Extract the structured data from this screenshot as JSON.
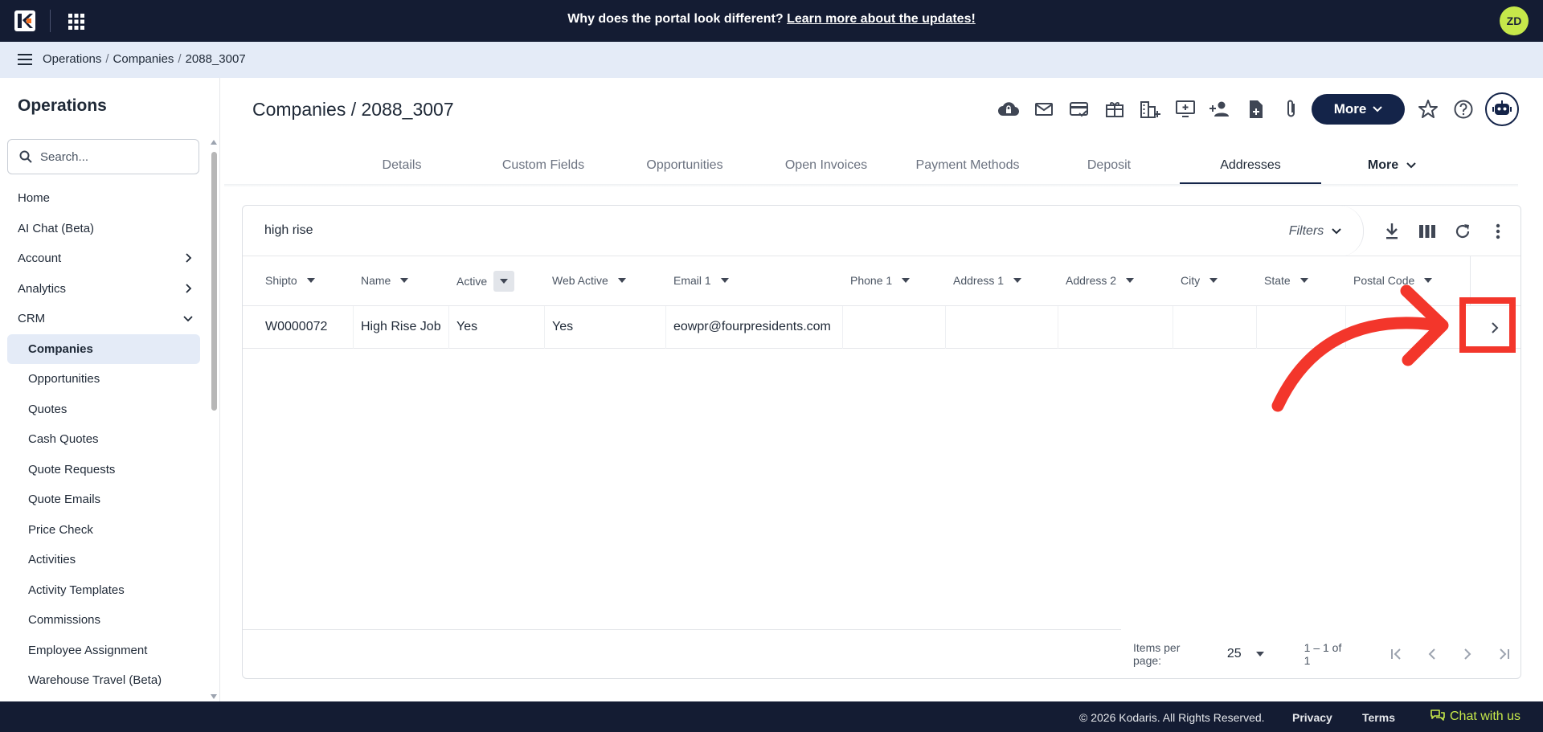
{
  "banner": {
    "prefix": "Why does the portal look different? ",
    "link": "Learn more about the updates!"
  },
  "user": {
    "initials": "ZD"
  },
  "breadcrumb": {
    "items": [
      "Operations",
      "Companies",
      "2088_3007"
    ],
    "separator": "/"
  },
  "sidebar": {
    "title": "Operations",
    "search_placeholder": "Search...",
    "items": [
      {
        "label": "Home"
      },
      {
        "label": "AI Chat (Beta)"
      },
      {
        "label": "Account"
      },
      {
        "label": "Analytics"
      },
      {
        "label": "CRM"
      },
      {
        "label": "Companies"
      },
      {
        "label": "Opportunities"
      },
      {
        "label": "Quotes"
      },
      {
        "label": "Cash Quotes"
      },
      {
        "label": "Quote Requests"
      },
      {
        "label": "Quote Emails"
      },
      {
        "label": "Price Check"
      },
      {
        "label": "Activities"
      },
      {
        "label": "Activity Templates"
      },
      {
        "label": "Commissions"
      },
      {
        "label": "Employee Assignment"
      },
      {
        "label": "Warehouse Travel (Beta)"
      }
    ]
  },
  "page": {
    "title": "Companies / 2088_3007",
    "more_label": "More"
  },
  "toolbar_icons": [
    "cloud-lock-icon",
    "mail-icon",
    "card-check-icon",
    "gift-icon",
    "buildings-add-icon",
    "monitor-add-icon",
    "person-add-icon",
    "file-add-icon",
    "paperclip-icon"
  ],
  "tabs": [
    {
      "label": "Details"
    },
    {
      "label": "Custom Fields"
    },
    {
      "label": "Opportunities"
    },
    {
      "label": "Open Invoices"
    },
    {
      "label": "Payment Methods"
    },
    {
      "label": "Deposit"
    },
    {
      "label": "Addresses",
      "active": true
    },
    {
      "label": "More"
    }
  ],
  "filter": {
    "value": "high rise",
    "filters_label": "Filters"
  },
  "table": {
    "columns": [
      "Shipto",
      "Name",
      "Active",
      "Web Active",
      "Email 1",
      "Phone 1",
      "Address 1",
      "Address 2",
      "City",
      "State",
      "Postal Code"
    ],
    "rows": [
      {
        "shipto": "W0000072",
        "name": "High Rise Job",
        "active": "Yes",
        "web_active": "Yes",
        "email": "eowpr@fourpresidents.com",
        "phone": "",
        "address1": "",
        "address2": "",
        "city": "",
        "state": "",
        "postal": ""
      }
    ]
  },
  "pagination": {
    "items_per_page_label": "Items per page:",
    "items_per_page": "25",
    "range": "1 – 1 of 1"
  },
  "footer": {
    "copyright": "© 2026 Kodaris. All Rights Reserved.",
    "privacy": "Privacy",
    "terms": "Terms",
    "chat": "Chat with us"
  },
  "colors": {
    "navy": "#141c33",
    "accent_navy": "#142449",
    "lime": "#c6e84a",
    "light_blue": "#e4ebf7",
    "annotation_red": "#f3362b"
  }
}
